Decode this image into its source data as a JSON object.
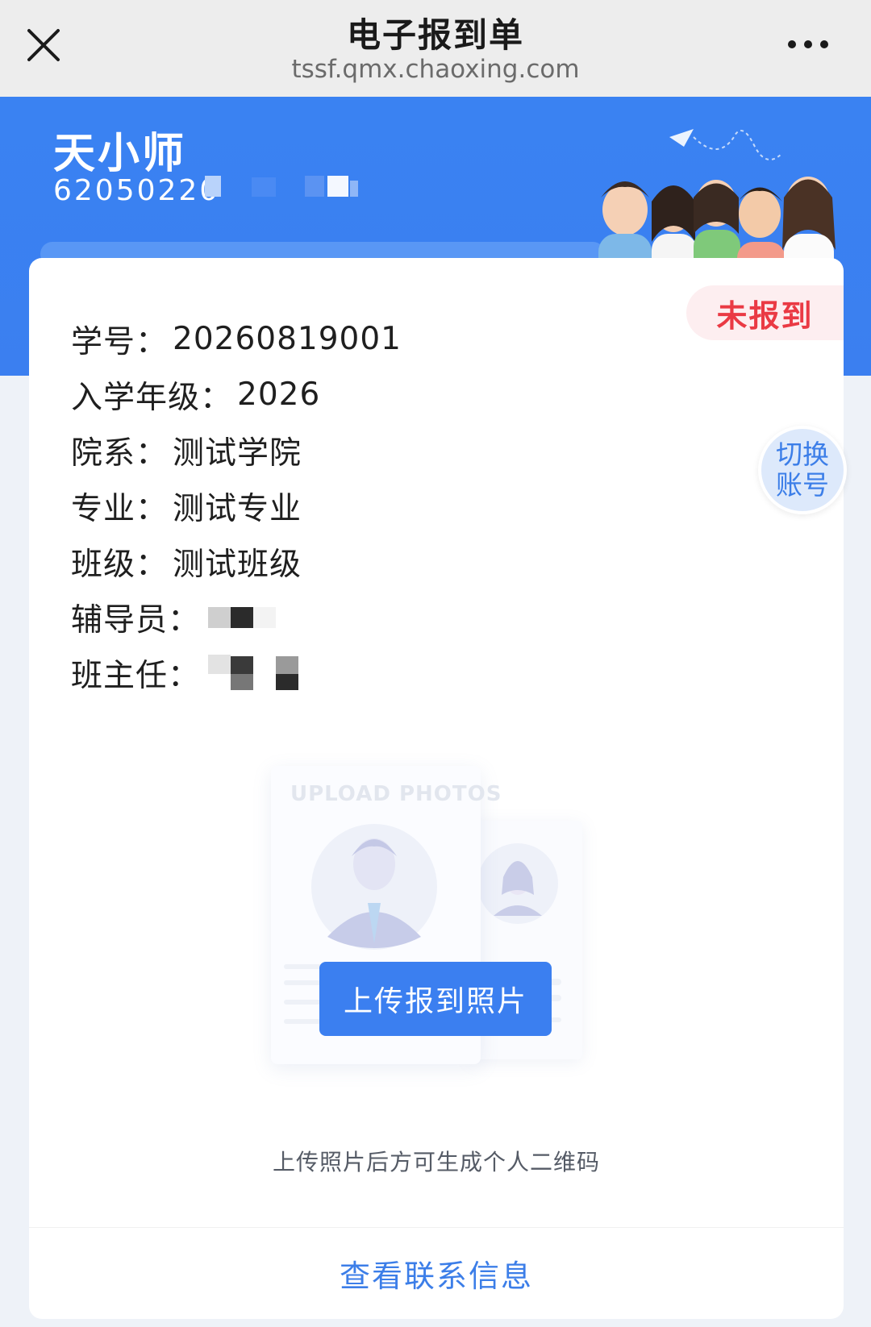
{
  "nav": {
    "title": "电子报到单",
    "url": "tssf.qmx.chaoxing.com",
    "close_icon": "close-icon",
    "more_icon": "more-icon"
  },
  "header": {
    "name": "天小师",
    "id_visible": "62050220"
  },
  "status": {
    "label": "未报到",
    "color": "#ea3a44"
  },
  "student_info": [
    {
      "label": "学号：",
      "value": "20260819001"
    },
    {
      "label": "入学年级：",
      "value": "2026"
    },
    {
      "label": "院系：",
      "value": "测试学院"
    },
    {
      "label": "专业：",
      "value": "测试专业"
    },
    {
      "label": "班级：",
      "value": "测试班级"
    },
    {
      "label": "辅导员：",
      "value": ""
    },
    {
      "label": "班主任：",
      "value": ""
    }
  ],
  "switch_account": {
    "line1": "切换",
    "line2": "账号"
  },
  "upload": {
    "illustration_text": "UPLOAD PHOTOS",
    "button_label": "上传报到照片",
    "hint": "上传照片后方可生成个人二维码"
  },
  "footer": {
    "contact_link": "查看联系信息"
  },
  "colors": {
    "primary": "#3b7ff0",
    "status_red": "#ea3a44",
    "link_blue": "#3c7ee8"
  }
}
